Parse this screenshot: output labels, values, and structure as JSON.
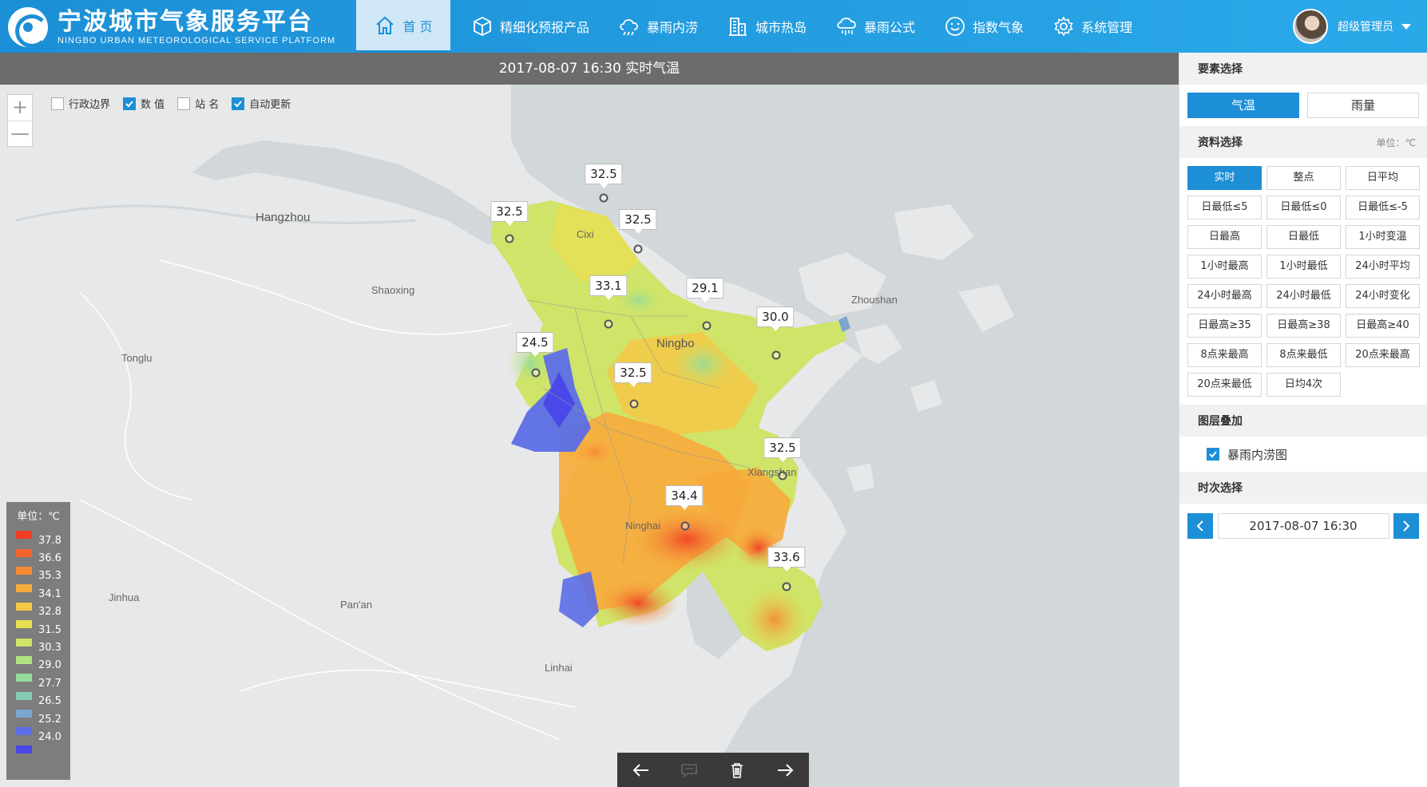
{
  "app": {
    "title_cn": "宁波城市气象服务平台",
    "title_en": "NINGBO URBAN METEOROLOGICAL SERVICE PLATFORM"
  },
  "nav": [
    {
      "label": "首 页",
      "icon": "home-icon"
    },
    {
      "label": "精细化预报产品",
      "icon": "cube-icon"
    },
    {
      "label": "暴雨内涝",
      "icon": "rain-cloud-icon"
    },
    {
      "label": "城市热岛",
      "icon": "building-icon"
    },
    {
      "label": "暴雨公式",
      "icon": "cloud-rain-icon"
    },
    {
      "label": "指数气象",
      "icon": "smile-icon"
    },
    {
      "label": "系统管理",
      "icon": "gear-icon"
    }
  ],
  "user": {
    "name": "超级管理员"
  },
  "map": {
    "title": "2017-08-07 16:30 实时气温",
    "zoom_in": "+",
    "zoom_out": "—",
    "options": [
      {
        "label": "行政边界",
        "checked": false
      },
      {
        "label": "数 值",
        "checked": true
      },
      {
        "label": "站 名",
        "checked": false
      },
      {
        "label": "自动更新",
        "checked": true
      }
    ],
    "cities": [
      "Hangzhou",
      "Shaoxing",
      "Tonglu",
      "Zhoushan",
      "Ningbo",
      "Jinhua",
      "Pan'an",
      "Linhai",
      "Xiangshan",
      "Ninghai",
      "Cixi"
    ],
    "stations": [
      "32.5",
      "32.5",
      "32.5",
      "33.1",
      "29.1",
      "30.0",
      "24.5",
      "32.5",
      "32.5",
      "34.4",
      "33.6"
    ]
  },
  "legend": {
    "title": "单位：℃",
    "values": [
      "37.8",
      "36.6",
      "35.3",
      "34.1",
      "32.8",
      "31.5",
      "30.3",
      "29.0",
      "27.7",
      "26.5",
      "25.2",
      "24.0"
    ],
    "colors": [
      "#f03c24",
      "#f4642c",
      "#f78a34",
      "#f7aa3c",
      "#f5c846",
      "#e8df52",
      "#cfe468",
      "#b2e27e",
      "#94dc9a",
      "#88c9b8",
      "#7aa6cf",
      "#5b6ee6",
      "#4a48e8"
    ]
  },
  "panel": {
    "element_title": "要素选择",
    "element_options": [
      {
        "label": "气温",
        "active": true
      },
      {
        "label": "雨量",
        "active": false
      }
    ],
    "data_title": "资料选择",
    "data_unit": "单位：℃",
    "data_options": [
      "实时",
      "整点",
      "日平均",
      "日最低≤5",
      "日最低≤0",
      "日最低≤-5",
      "日最高",
      "日最低",
      "1小时变温",
      "1小时最高",
      "1小时最低",
      "24小时平均",
      "24小时最高",
      "24小时最低",
      "24小时变化",
      "日最高≥35",
      "日最高≥38",
      "日最高≥40",
      "8点来最高",
      "8点来最低",
      "20点来最高",
      "20点来最低",
      "日均4次"
    ],
    "layer_title": "图层叠加",
    "layer_label": "暴雨内涝图",
    "time_title": "时次选择",
    "time_value": "2017-08-07 16:30"
  }
}
